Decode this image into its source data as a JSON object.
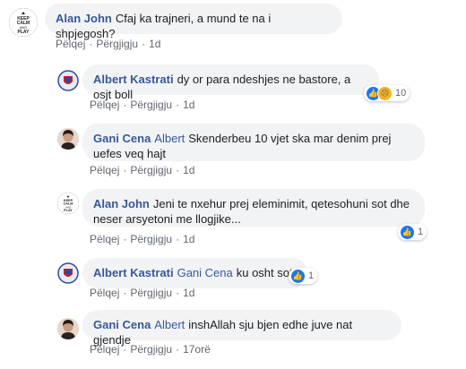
{
  "actions": {
    "like": "Pëlqej",
    "reply": "Përgjigju"
  },
  "comments": [
    {
      "author": "Alan John",
      "mention": "",
      "text": "Cfaj ka trajneri, a mund te na i shpjegosh?",
      "time": "1d",
      "avatar_icon": "keep-calm-avatar",
      "avatar_text": "KEEP CALM AND PLAY"
    },
    {
      "author": "Albert Kastrati",
      "mention": "",
      "text": "dy or para ndeshjes ne bastore, a osjt boll",
      "time": "1d",
      "avatar_icon": "club-crest-avatar",
      "reaction_count": "10"
    },
    {
      "author": "Gani Cena",
      "mention": "Albert",
      "text": "Skenderbeu 10 vjet ska mar denim prej uefes veq hajt",
      "time": "1d",
      "avatar_icon": "person-photo-avatar"
    },
    {
      "author": "Alan John",
      "mention": "",
      "text": "Jeni te nxehur prej eleminimit, qetesohuni sot dhe neser arsyetoni me llogjike...",
      "time": "1d",
      "avatar_icon": "keep-calm-avatar",
      "avatar_text": "KEEP CALM AND PLAY",
      "reaction_count": "1"
    },
    {
      "author": "Albert Kastrati",
      "mention": "Gani Cena",
      "text": "ku osht sot",
      "time": "1d",
      "avatar_icon": "club-crest-avatar",
      "reaction_count": "1"
    },
    {
      "author": "Gani Cena",
      "mention": "Albert",
      "text": "inshAllah sju bjen edhe juve nat gjendje",
      "time": "17orë",
      "avatar_icon": "person-photo-avatar"
    }
  ],
  "colors": {
    "link": "#385898",
    "bubble": "#f2f3f5",
    "like": "#1877f2",
    "meta": "#606770"
  }
}
